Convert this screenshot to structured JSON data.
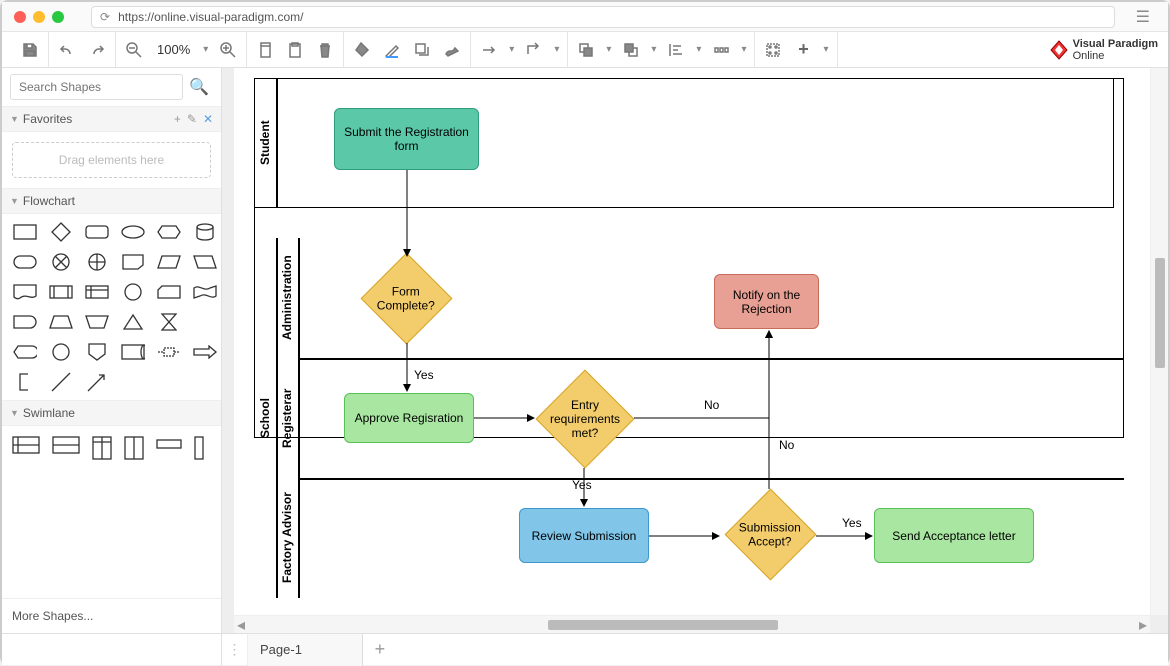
{
  "url": "https://online.visual-paradigm.com/",
  "brand": {
    "line1": "Visual Paradigm",
    "line2": "Online"
  },
  "toolbar": {
    "zoom": "100%"
  },
  "sidebar": {
    "search_placeholder": "Search Shapes",
    "favorites_label": "Favorites",
    "drop_hint": "Drag elements here",
    "flowchart_label": "Flowchart",
    "swimlane_label": "Swimlane",
    "more_shapes": "More Shapes..."
  },
  "tabs": {
    "page1": "Page-1"
  },
  "lanes": {
    "student": "Student",
    "school": "School",
    "administration": "Administration",
    "registerar": "Registerar",
    "factory_advisor": "Factory Advisor"
  },
  "nodes": {
    "submit": "Submit the Registration form",
    "form_complete": "Form Complete?",
    "approve": "Approve Regisration",
    "entry_req": "Entry requirements met?",
    "notify_reject": "Notify on the Rejection",
    "review": "Review Submission",
    "sub_accept": "Submission Accept?",
    "send_accept": "Send Acceptance letter"
  },
  "labels": {
    "yes": "Yes",
    "no": "No"
  },
  "colors": {
    "teal": "#5bc9a8",
    "teal_border": "#2f9c7d",
    "green": "#a8e6a1",
    "green_border": "#57c257",
    "orange": "#f3cd6c",
    "orange_border": "#d6a424",
    "red": "#e8a094",
    "red_border": "#c96b5b",
    "blue": "#81c5e8",
    "blue_border": "#3d98cc"
  }
}
